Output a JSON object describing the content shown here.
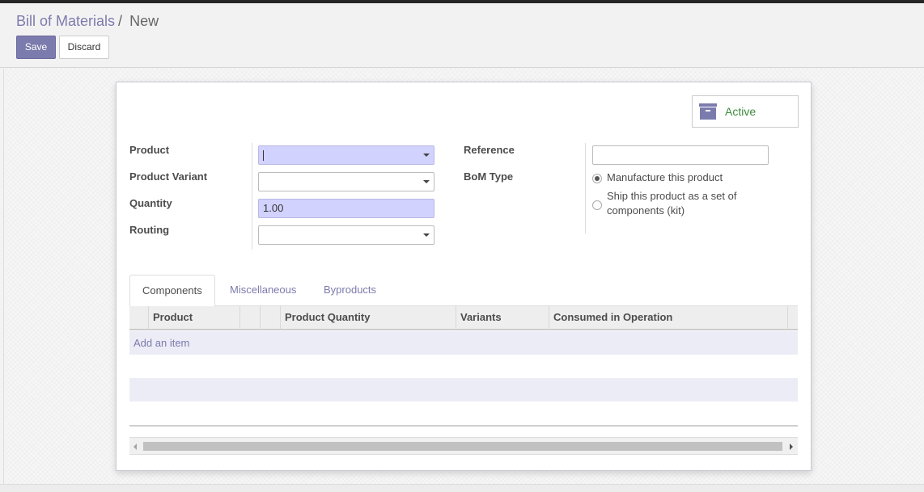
{
  "breadcrumb": {
    "parent": "Bill of Materials",
    "separator": "/",
    "current": "New"
  },
  "toolbar": {
    "save_label": "Save",
    "discard_label": "Discard"
  },
  "status_button": {
    "label": "Active",
    "icon": "archive-icon"
  },
  "form": {
    "left": {
      "product": {
        "label": "Product",
        "value": ""
      },
      "product_variant": {
        "label": "Product Variant",
        "value": ""
      },
      "quantity": {
        "label": "Quantity",
        "value": "1.00"
      },
      "routing": {
        "label": "Routing",
        "value": ""
      }
    },
    "right": {
      "reference": {
        "label": "Reference",
        "value": ""
      },
      "bom_type": {
        "label": "BoM Type",
        "options": [
          {
            "label": "Manufacture this product",
            "checked": true
          },
          {
            "label_line1": "Ship this product as a set of",
            "label_line2": "components (kit)",
            "checked": false
          }
        ]
      }
    }
  },
  "tabs": [
    {
      "label": "Components",
      "active": true
    },
    {
      "label": "Miscellaneous",
      "active": false
    },
    {
      "label": "Byproducts",
      "active": false
    }
  ],
  "grid": {
    "columns": [
      "Product",
      "",
      "",
      "Product Quantity",
      "Variants",
      "Consumed in Operation"
    ],
    "add_item_label": "Add an item"
  },
  "colors": {
    "accent": "#7c7bad",
    "required_bg": "#d2d2ff",
    "active_green": "#3c8a3c"
  }
}
